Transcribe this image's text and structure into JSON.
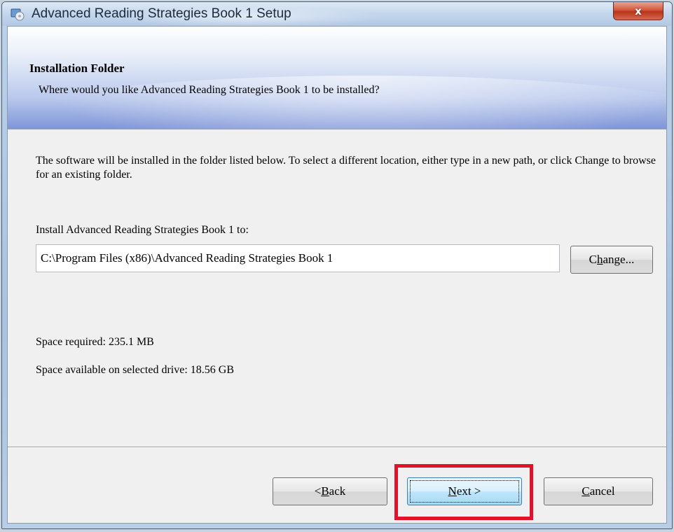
{
  "window": {
    "title": "Advanced Reading Strategies Book 1 Setup",
    "close_label": "x"
  },
  "header": {
    "title": "Installation Folder",
    "subtitle": "Where would you like Advanced Reading Strategies Book 1 to be installed?"
  },
  "body": {
    "description": "The software will be installed in the folder listed below. To select a different location, either type in a new path, or click Change to browse for an existing folder.",
    "path_label": "Install Advanced Reading Strategies Book 1 to:",
    "path_value": "C:\\Program Files (x86)\\Advanced Reading Strategies Book 1",
    "change_button": {
      "pre": "C",
      "accel": "h",
      "post": "ange..."
    },
    "space_required": "Space required: 235.1 MB",
    "space_available": "Space available on selected drive: 18.56 GB"
  },
  "footer": {
    "back_button": {
      "pre": "< ",
      "accel": "B",
      "post": "ack"
    },
    "next_button": {
      "pre": "",
      "accel": "N",
      "post": "ext >"
    },
    "cancel_button": {
      "pre": "",
      "accel": "C",
      "post": "ancel"
    }
  },
  "colors": {
    "highlight": "#e0132a",
    "close_button": "#c9472b",
    "banner_accent": "#7f95d8"
  },
  "icons": {
    "app": "setup-disc-icon",
    "close": "close-icon"
  }
}
